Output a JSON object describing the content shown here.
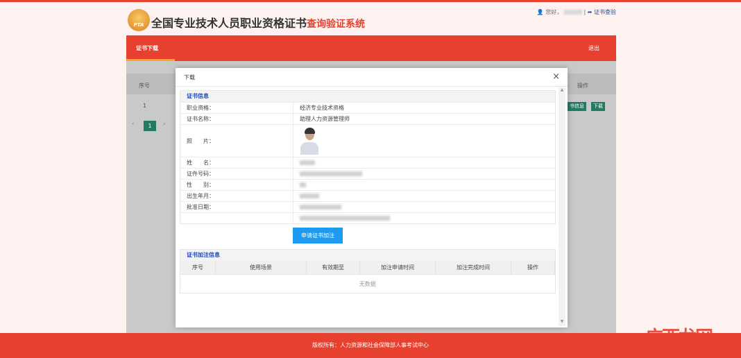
{
  "header": {
    "logo_text": "PTA",
    "title_main": "全国专业技术人员职业资格证书",
    "title_sub": "查询验证系统",
    "greeting": "您好，",
    "separator": "|",
    "verify_link": "证书查验"
  },
  "nav": {
    "tab": "证书下载",
    "logout": "退出"
  },
  "background_table": {
    "col_index": "序号",
    "col_action": "操作",
    "row_index": "1",
    "btn_info": "书信息",
    "btn_download": "下载",
    "page_prev": "‹",
    "page_current": "1",
    "page_next": "›"
  },
  "modal": {
    "title": "下载",
    "close": "×",
    "cert_section_title": "证书信息",
    "fields": [
      {
        "label": "职业资格：",
        "value": "经济专业技术资格"
      },
      {
        "label": "证书名称：",
        "value": "助理人力资源管理师"
      },
      {
        "label": "照　　片：",
        "value": ""
      },
      {
        "label": "姓　　名：",
        "value": ""
      },
      {
        "label": "证件号码：",
        "value": ""
      },
      {
        "label": "性　　别：",
        "value": ""
      },
      {
        "label": "出生年月：",
        "value": ""
      },
      {
        "label": "批准日期：",
        "value": ""
      },
      {
        "label": "",
        "value": ""
      }
    ],
    "apply_button": "申请证书加注",
    "annot_section_title": "证书加注信息",
    "annot_columns": [
      "序号",
      "使用场景",
      "有效期至",
      "加注申请时间",
      "加注完成时间",
      "操作"
    ],
    "annot_empty": "无数据"
  },
  "footer": {
    "copyright": "版权所有：人力资源和社会保障部人事考试中心"
  },
  "watermark": "广西龙网"
}
